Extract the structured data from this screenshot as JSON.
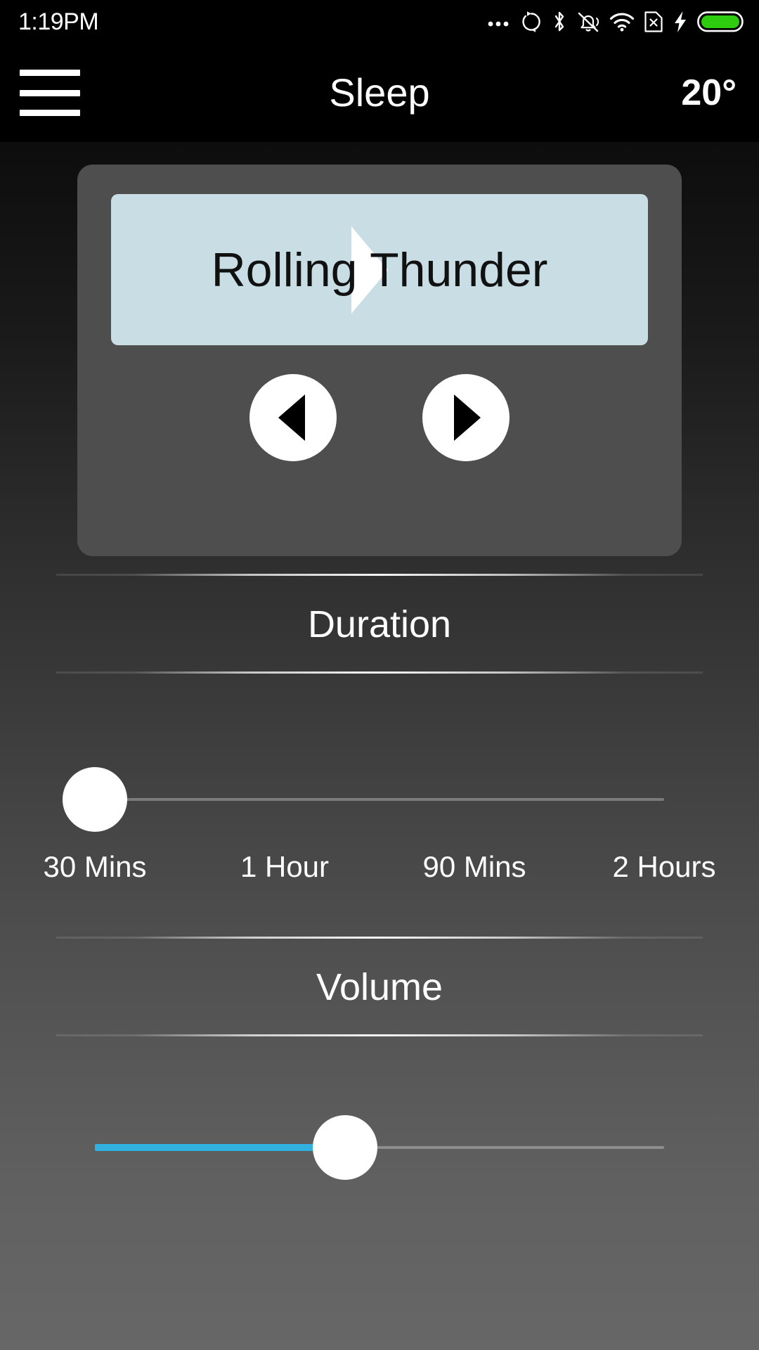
{
  "statusbar": {
    "time": "1:19PM",
    "icons": [
      {
        "name": "more-dots-icon",
        "label": "more"
      },
      {
        "name": "sync-rotate-icon",
        "label": "sync"
      },
      {
        "name": "bluetooth-icon",
        "label": "bluetooth"
      },
      {
        "name": "mute-bell-icon",
        "label": "silent"
      },
      {
        "name": "wifi-icon",
        "label": "wifi"
      },
      {
        "name": "no-sim-icon",
        "label": "no sim"
      },
      {
        "name": "charging-bolt-icon",
        "label": "charging"
      },
      {
        "name": "battery-icon",
        "label": "battery"
      }
    ],
    "battery_color": "#2ecc0f"
  },
  "appbar": {
    "menu_icon": "hamburger-menu-icon",
    "title": "Sleep",
    "temperature": "20°"
  },
  "player": {
    "track_title": "Rolling Thunder",
    "play_icon": "play-triangle-icon",
    "prev_label": "Previous",
    "next_label": "Next",
    "panel_color": "#c8dde4",
    "card_color": "#4e4e4e"
  },
  "duration": {
    "label": "Duration",
    "value_index": 0,
    "percent": 0,
    "options": [
      "30 Mins",
      "1 Hour",
      "90 Mins",
      "2 Hours"
    ]
  },
  "volume": {
    "label": "Volume",
    "percent": 44,
    "fill_color": "#32b0df"
  }
}
